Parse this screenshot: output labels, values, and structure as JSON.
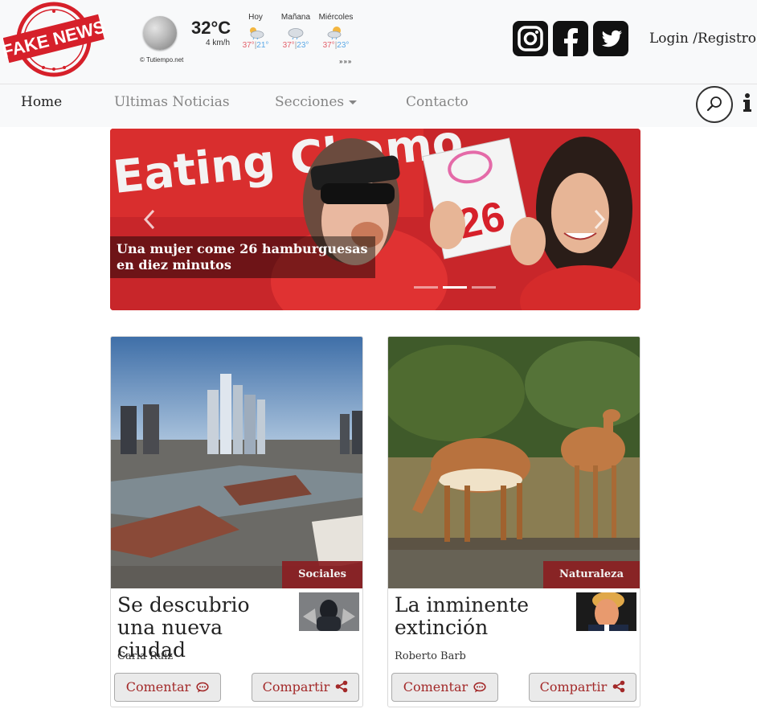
{
  "brand": {
    "logo_text": "FAKE NEWS"
  },
  "weather": {
    "credit": "© Tutiempo.net",
    "temperature": "32°C",
    "wind": "4 km/h",
    "days": [
      {
        "label": "Hoy",
        "high": "37°",
        "low": "21°",
        "icon": "partly-cloudy-icon"
      },
      {
        "label": "Mañana",
        "high": "37°",
        "low": "23°",
        "icon": "cloudy-icon"
      },
      {
        "label": "Miércoles",
        "high": "37°",
        "low": "23°",
        "icon": "sun-cloud-icon"
      }
    ],
    "separator": "|",
    "more": "»»»"
  },
  "social": [
    "instagram-icon",
    "facebook-icon",
    "twitter-icon"
  ],
  "account": {
    "login": "Login",
    "separator": " /",
    "register": "Registro"
  },
  "nav": {
    "items": [
      {
        "label": "Home",
        "active": true
      },
      {
        "label": "Ultimas Noticias",
        "active": false
      },
      {
        "label": "Secciones",
        "active": false,
        "dropdown": true
      },
      {
        "label": "Contacto",
        "active": false
      }
    ],
    "search_icon": "search-icon",
    "info_icon": "info-icon"
  },
  "carousel": {
    "caption": "Una mujer come 26 hamburguesas en diez minutos",
    "banner_text": "Eating Chamo",
    "sign_number": "26",
    "slides": 3,
    "active_slide": 2
  },
  "cards": [
    {
      "section": "Sociales",
      "title": "Se descubrio una nueva ciudad",
      "author": "Carla Ruiz",
      "comment_label": "Comentar",
      "share_label": "Compartir"
    },
    {
      "section": "Naturaleza",
      "title": "La inminente extinción",
      "author": "Roberto Barb",
      "comment_label": "Comentar",
      "share_label": "Compartir"
    }
  ],
  "colors": {
    "accent": "#a32929",
    "badge": "#8b1f22",
    "header_bg": "#f8f9fa"
  }
}
